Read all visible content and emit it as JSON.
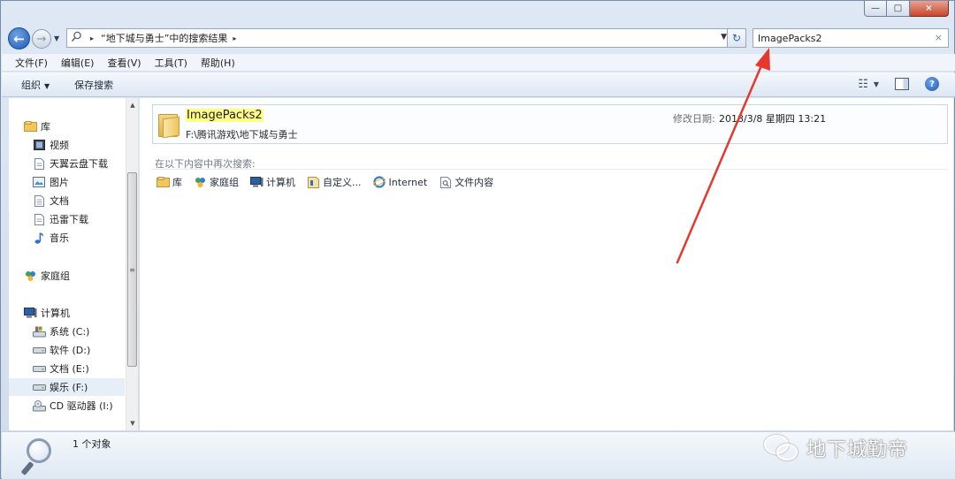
{
  "window": {
    "caption_buttons": {
      "minimize": "—",
      "maximize": "□",
      "close": "×"
    }
  },
  "nav": {
    "back_glyph": "←",
    "forward_glyph": "→",
    "history_glyph": "▼",
    "address_icon": "search-icon",
    "address_sep": "▸",
    "address_crumb": "“地下城与勇士”中的搜索结果",
    "address_dropdown": "▼",
    "refresh_glyph": "↻",
    "search_value": "ImagePacks2",
    "search_clear": "×"
  },
  "menubar": {
    "items": [
      "文件(F)",
      "编辑(E)",
      "查看(V)",
      "工具(T)",
      "帮助(H)"
    ]
  },
  "cmdbar": {
    "organize": "组织",
    "organize_caret": "▼",
    "save_search": "保存搜索",
    "view_glyph": "☷",
    "view_caret": "▼",
    "help_glyph": "?"
  },
  "navpane": {
    "libraries": "库",
    "lib_items": [
      "视频",
      "天翼云盘下载",
      "图片",
      "文档",
      "迅雷下载",
      "音乐"
    ],
    "homegroup": "家庭组",
    "computer": "计算机",
    "drives": [
      "系统 (C:)",
      "软件 (D:)",
      "文档 (E:)",
      "娱乐 (F:)",
      "CD 驱动器 (I:)"
    ],
    "selected_drive": "娱乐 (F:)",
    "scroll_up": "▲",
    "scroll_down": "▼",
    "scroll_grip": "≡"
  },
  "content": {
    "result": {
      "name": "ImagePacks2",
      "path": "F:\\腾讯游戏\\地下城与勇士",
      "date_label": "修改日期:",
      "date_value": "2018/3/8 星期四 13:21"
    },
    "search_again_label": "在以下内容中再次搜索:",
    "search_again_items": [
      "库",
      "家庭组",
      "计算机",
      "自定义...",
      "Internet",
      "文件内容"
    ]
  },
  "statusbar": {
    "count_text": "1 个对象",
    "watermark": "地下城勤帝"
  },
  "colors": {
    "accent_blue": "#1f59b4",
    "highlight_yellow": "#fffd84",
    "annotation_red": "#e8372c"
  }
}
